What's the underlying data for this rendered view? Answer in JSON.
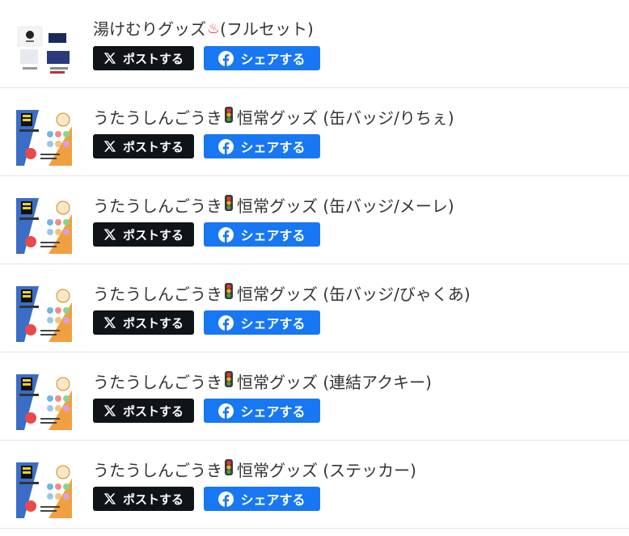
{
  "items": [
    {
      "title": "湯けむりグッズ",
      "title_suffix": " (フルセット)",
      "title_icon": "hot-springs-icon",
      "thumb_icon": "yukemuri-goods-thumbnail",
      "post_label": "ポストする",
      "share_label": "シェアする"
    },
    {
      "title": "うたうしんごうき",
      "title_suffix": "恒常グッズ (缶バッジ/りちぇ)",
      "title_icon": "traffic-light-icon",
      "thumb_icon": "utau-shingouki-goods-thumbnail",
      "post_label": "ポストする",
      "share_label": "シェアする"
    },
    {
      "title": "うたうしんごうき",
      "title_suffix": "恒常グッズ (缶バッジ/メーレ)",
      "title_icon": "traffic-light-icon",
      "thumb_icon": "utau-shingouki-goods-thumbnail",
      "post_label": "ポストする",
      "share_label": "シェアする"
    },
    {
      "title": "うたうしんごうき",
      "title_suffix": "恒常グッズ (缶バッジ/びゃくあ)",
      "title_icon": "traffic-light-icon",
      "thumb_icon": "utau-shingouki-goods-thumbnail",
      "post_label": "ポストする",
      "share_label": "シェアする"
    },
    {
      "title": "うたうしんごうき",
      "title_suffix": "恒常グッズ (連結アクキー)",
      "title_icon": "traffic-light-icon",
      "thumb_icon": "utau-shingouki-goods-thumbnail",
      "post_label": "ポストする",
      "share_label": "シェアする"
    },
    {
      "title": "うたうしんごうき",
      "title_suffix": "恒常グッズ (ステッカー)",
      "title_icon": "traffic-light-icon",
      "thumb_icon": "utau-shingouki-goods-thumbnail",
      "post_label": "ポストする",
      "share_label": "シェアする"
    }
  ],
  "colors": {
    "x_button_bg": "#0f1419",
    "fb_button_bg": "#1877f2",
    "divider": "#e5e5e5",
    "title_text": "#333333"
  }
}
